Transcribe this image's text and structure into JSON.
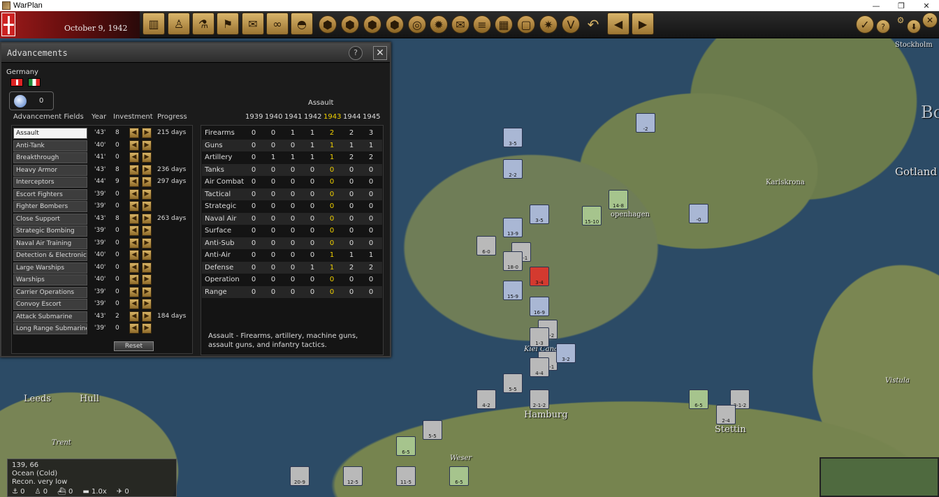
{
  "window": {
    "title": "WarPlan",
    "min": "—",
    "max": "❐",
    "close": "✕"
  },
  "topbar": {
    "date": "October 9, 1942",
    "left_icons": [
      "factory-icon",
      "soldier-icon",
      "microscope-icon",
      "flag-icon",
      "report-icon",
      "binoculars-icon",
      "helmet-icon"
    ],
    "hex_icons": [
      "hex-1",
      "hex-2",
      "hex-3",
      "hex-4",
      "hex-5",
      "hex-6",
      "hex-7",
      "hex-8",
      "hex-9",
      "hex-10",
      "hex-11",
      "hex-12"
    ],
    "right": {
      "undo": "↶",
      "prev": "◀",
      "next": "▶",
      "confirm": "✓",
      "help": "?",
      "gear": "⚙",
      "save": "⬇"
    }
  },
  "map": {
    "labels": {
      "stockholm": "Stockholm",
      "gotland": "Gotland",
      "karlskrona": "Karlskrona",
      "copenhagen": "openhagen",
      "leeds": "Leeds",
      "hull": "Hull",
      "trent": "Trent",
      "weser": "Weser",
      "hamburg": "Hamburg",
      "stettin": "Stettin",
      "vistula": "Vistula",
      "kiel": "Kiel Canal",
      "b": "Bo"
    },
    "units": [
      {
        "id": "u1",
        "label": "3-5"
      },
      {
        "id": "u2",
        "label": "2-2"
      },
      {
        "id": "u3",
        "label": "3-5"
      },
      {
        "id": "u4",
        "label": "14-8"
      },
      {
        "id": "u5",
        "label": "15-10"
      },
      {
        "id": "u6",
        "label": "13-9"
      },
      {
        "id": "u7",
        "label": "6-0"
      },
      {
        "id": "u8",
        "label": "6-2-1"
      },
      {
        "id": "u9",
        "label": "18-0"
      },
      {
        "id": "u10",
        "label": "3-4"
      },
      {
        "id": "u11",
        "label": "15-9"
      },
      {
        "id": "u12",
        "label": "16-9"
      },
      {
        "id": "u13",
        "label": "2-1-2"
      },
      {
        "id": "u14",
        "label": "1-3"
      },
      {
        "id": "u15",
        "label": "5-2-1"
      },
      {
        "id": "u16",
        "label": "4-4"
      },
      {
        "id": "u17",
        "label": "5-5"
      },
      {
        "id": "u18",
        "label": "3-2"
      },
      {
        "id": "u19",
        "label": "2-1-2"
      },
      {
        "id": "u20",
        "label": "6-5"
      },
      {
        "id": "u21",
        "label": "3-1-2"
      },
      {
        "id": "u22",
        "label": "2-4"
      },
      {
        "id": "u23",
        "label": "5-5"
      },
      {
        "id": "u24",
        "label": "6-5"
      },
      {
        "id": "u25",
        "label": "20-9"
      },
      {
        "id": "u26",
        "label": "12-5"
      },
      {
        "id": "u27",
        "label": "11-5"
      },
      {
        "id": "u28",
        "label": "6-5"
      },
      {
        "id": "u29",
        "label": "4-2"
      },
      {
        "id": "u30",
        "label": "-2"
      },
      {
        "id": "u31",
        "label": "-0"
      }
    ]
  },
  "tileinfo": {
    "coords": "139, 66",
    "terrain": "Ocean (Cold)",
    "recon": "Recon. very low",
    "counts": [
      {
        "icon": "anchor-icon",
        "v": "0"
      },
      {
        "icon": "soldier-icon",
        "v": "0"
      },
      {
        "icon": "ship-icon",
        "v": "0"
      },
      {
        "icon": "zoom-icon",
        "v": "1.0x"
      },
      {
        "icon": "plane-icon",
        "v": "0"
      }
    ]
  },
  "panel": {
    "title": "Advancements",
    "help": "?",
    "close": "✕",
    "nation": "Germany",
    "research_points": "0",
    "headers": {
      "fields": "Advancement Fields",
      "year": "Year",
      "investment": "Investment",
      "progress": "Progress"
    },
    "fields": [
      {
        "name": "Assault",
        "year": "'43'",
        "inv": "8",
        "prog": "215 days"
      },
      {
        "name": "Anti-Tank",
        "year": "'40'",
        "inv": "0",
        "prog": ""
      },
      {
        "name": "Breakthrough",
        "year": "'41'",
        "inv": "0",
        "prog": ""
      },
      {
        "name": "Heavy Armor",
        "year": "'43'",
        "inv": "8",
        "prog": "236 days"
      },
      {
        "name": "Interceptors",
        "year": "'44'",
        "inv": "9",
        "prog": "297 days"
      },
      {
        "name": "Escort Fighters",
        "year": "'39'",
        "inv": "0",
        "prog": ""
      },
      {
        "name": "Fighter Bombers",
        "year": "'39'",
        "inv": "0",
        "prog": ""
      },
      {
        "name": "Close Support",
        "year": "'43'",
        "inv": "8",
        "prog": "263 days"
      },
      {
        "name": "Strategic Bombing",
        "year": "'39'",
        "inv": "0",
        "prog": ""
      },
      {
        "name": "Naval Air Training",
        "year": "'39'",
        "inv": "0",
        "prog": ""
      },
      {
        "name": "Detection & Electronics",
        "year": "'40'",
        "inv": "0",
        "prog": ""
      },
      {
        "name": "Large Warships",
        "year": "'40'",
        "inv": "0",
        "prog": ""
      },
      {
        "name": "Warships",
        "year": "'40'",
        "inv": "0",
        "prog": ""
      },
      {
        "name": "Carrier Operations",
        "year": "'39'",
        "inv": "0",
        "prog": ""
      },
      {
        "name": "Convoy Escort",
        "year": "'39'",
        "inv": "0",
        "prog": ""
      },
      {
        "name": "Attack Submarine",
        "year": "'43'",
        "inv": "2",
        "prog": "184 days"
      },
      {
        "name": "Long Range Submarine",
        "year": "'39'",
        "inv": "0",
        "prog": ""
      }
    ],
    "reset": "Reset",
    "group": "Assault",
    "years": [
      "1939",
      "1940",
      "1941",
      "1942",
      "1943",
      "1944",
      "1945"
    ],
    "current_year_index": 4,
    "techs": [
      {
        "name": "Firearms",
        "v": [
          "0",
          "0",
          "1",
          "1",
          "2",
          "2",
          "3"
        ]
      },
      {
        "name": "Guns",
        "v": [
          "0",
          "0",
          "0",
          "1",
          "1",
          "1",
          "1"
        ]
      },
      {
        "name": "Artillery",
        "v": [
          "0",
          "1",
          "1",
          "1",
          "1",
          "2",
          "2"
        ]
      },
      {
        "name": "Tanks",
        "v": [
          "0",
          "0",
          "0",
          "0",
          "0",
          "0",
          "0"
        ]
      },
      {
        "name": "Air Combat",
        "v": [
          "0",
          "0",
          "0",
          "0",
          "0",
          "0",
          "0"
        ]
      },
      {
        "name": "Tactical",
        "v": [
          "0",
          "0",
          "0",
          "0",
          "0",
          "0",
          "0"
        ]
      },
      {
        "name": "Strategic",
        "v": [
          "0",
          "0",
          "0",
          "0",
          "0",
          "0",
          "0"
        ]
      },
      {
        "name": "Naval Air",
        "v": [
          "0",
          "0",
          "0",
          "0",
          "0",
          "0",
          "0"
        ]
      },
      {
        "name": "Surface",
        "v": [
          "0",
          "0",
          "0",
          "0",
          "0",
          "0",
          "0"
        ]
      },
      {
        "name": "Anti-Sub",
        "v": [
          "0",
          "0",
          "0",
          "0",
          "0",
          "0",
          "0"
        ]
      },
      {
        "name": "Anti-Air",
        "v": [
          "0",
          "0",
          "0",
          "0",
          "1",
          "1",
          "1"
        ]
      },
      {
        "name": "Defense",
        "v": [
          "0",
          "0",
          "0",
          "1",
          "1",
          "2",
          "2"
        ]
      },
      {
        "name": "Operation",
        "v": [
          "0",
          "0",
          "0",
          "0",
          "0",
          "0",
          "0"
        ]
      },
      {
        "name": "Range",
        "v": [
          "0",
          "0",
          "0",
          "0",
          "0",
          "0",
          "0"
        ]
      }
    ],
    "description": "Assault - Firearms, artillery, machine guns, assault guns, and infantry tactics."
  }
}
